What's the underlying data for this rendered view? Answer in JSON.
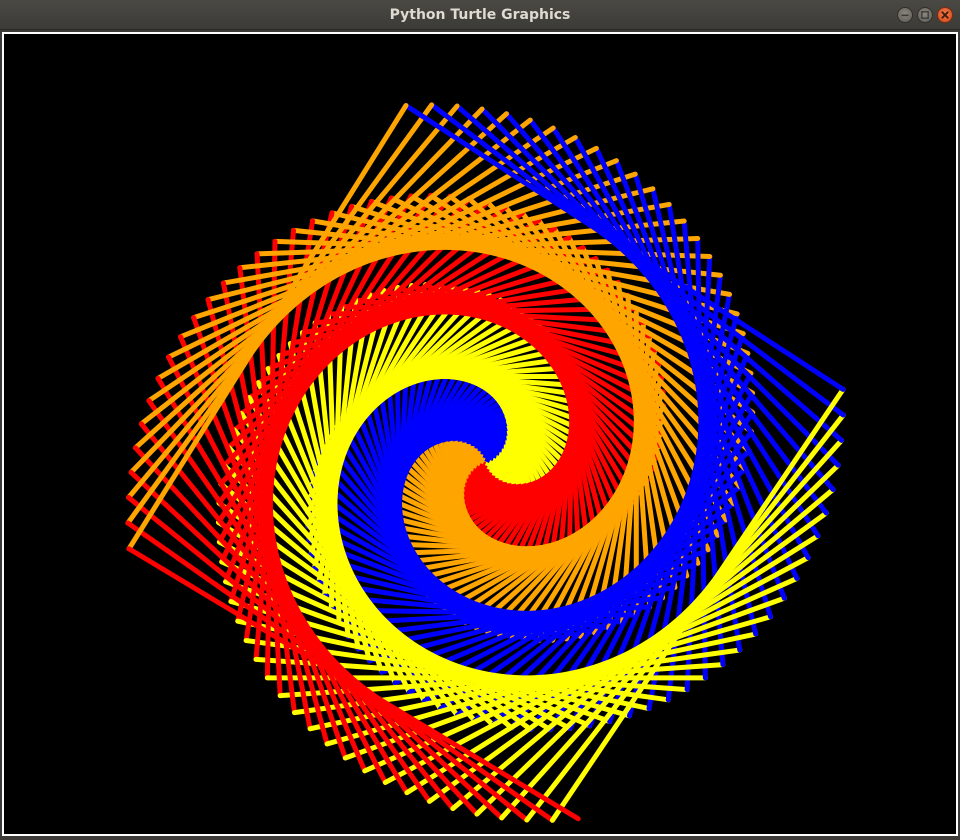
{
  "window": {
    "title": "Python Turtle Graphics"
  },
  "controls": {
    "minimize_icon": "minimize-icon",
    "maximize_icon": "maximize-icon",
    "close_icon": "close-icon"
  },
  "canvas": {
    "background": "#000000",
    "pen_colors": [
      "#ffff00",
      "#0000ff",
      "#ffa500",
      "#ff0000"
    ],
    "color_names": [
      "yellow",
      "blue",
      "orange",
      "red"
    ],
    "pattern": "square spiral"
  }
}
